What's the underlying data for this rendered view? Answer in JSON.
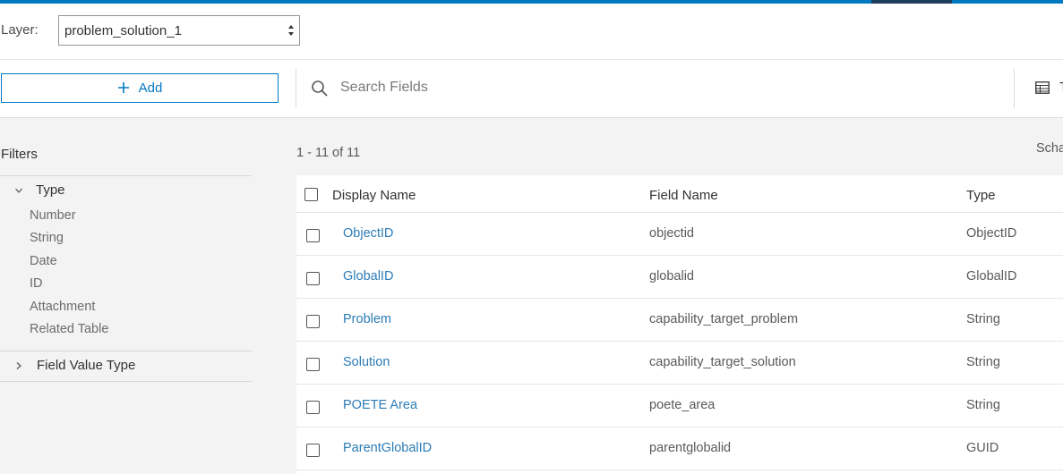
{
  "layer": {
    "label": "Layer:",
    "selected": "problem_solution_1"
  },
  "toolbar": {
    "add_label": "Add",
    "search_placeholder": "Search Fields",
    "table_button_label": "T"
  },
  "filters": {
    "title": "Filters",
    "type_group": {
      "title": "Type",
      "expanded": true,
      "items": [
        "Number",
        "String",
        "Date",
        "ID",
        "Attachment",
        "Related Table"
      ]
    },
    "field_value_type_group": {
      "title": "Field Value Type",
      "expanded": false
    }
  },
  "table": {
    "count": "1 - 11 of 11",
    "schema_link": "Scha",
    "columns": [
      "Display Name",
      "Field Name",
      "Type"
    ],
    "rows": [
      {
        "display_name": "ObjectID",
        "field_name": "objectid",
        "type": "ObjectID"
      },
      {
        "display_name": "GlobalID",
        "field_name": "globalid",
        "type": "GlobalID"
      },
      {
        "display_name": "Problem",
        "field_name": "capability_target_problem",
        "type": "String"
      },
      {
        "display_name": "Solution",
        "field_name": "capability_target_solution",
        "type": "String"
      },
      {
        "display_name": "POETE Area",
        "field_name": "poete_area",
        "type": "String"
      },
      {
        "display_name": "ParentGlobalID",
        "field_name": "parentglobalid",
        "type": "GUID"
      }
    ]
  },
  "colors": {
    "accent": "#0079c1",
    "accent_dark": "#1e3c5a",
    "link": "#2c7bb6",
    "background": "#f3f3f3"
  },
  "icons": [
    "plus-icon",
    "search-icon",
    "table-icon",
    "chevron-down-icon",
    "chevron-right-icon",
    "select-arrows-icon"
  ]
}
